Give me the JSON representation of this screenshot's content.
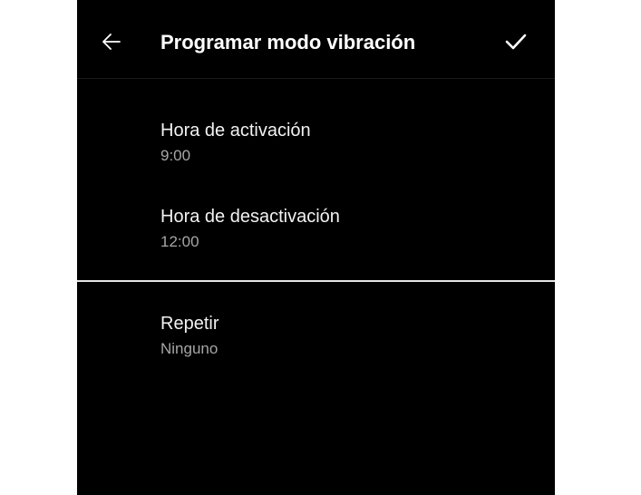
{
  "header": {
    "title": "Programar modo vibración",
    "back_icon": "arrow-left-icon",
    "confirm_icon": "check-icon"
  },
  "settings": [
    {
      "label": "Hora de activación",
      "value": "9:00"
    },
    {
      "label": "Hora de desactivación",
      "value": "12:00"
    },
    {
      "label": "Repetir",
      "value": "Ninguno"
    }
  ],
  "colors": {
    "background": "#000000",
    "primary_text": "#ffffff",
    "secondary_text": "#a6a6a6",
    "divider": "#e6e6e6"
  }
}
